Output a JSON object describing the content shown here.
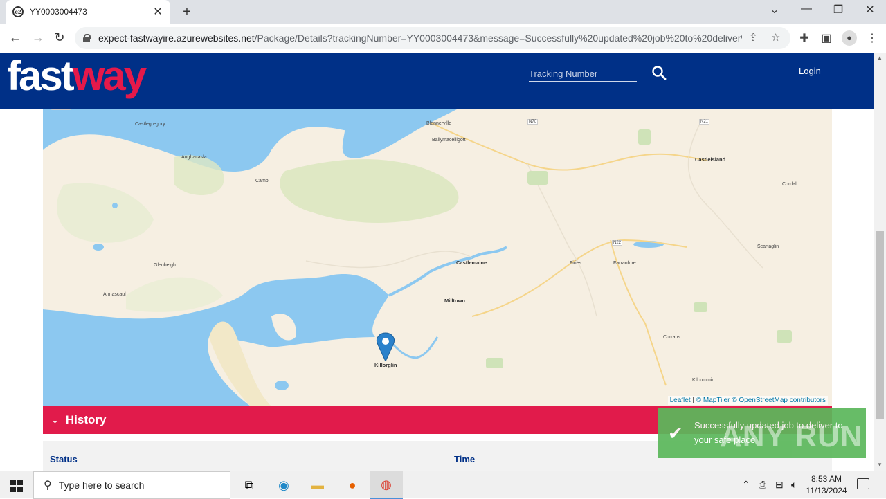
{
  "browser": {
    "tab_title": "YY0003004473",
    "url_host": "expect-fastwayire.azurewebsites.net",
    "url_path": "/Package/Details?trackingNumber=YY0003004473&message=Successfully%20updated%20job%20to%20deliver%..."
  },
  "header": {
    "logo_part1": "fast",
    "logo_part2": "way",
    "tracking_placeholder": "Tracking Number",
    "login_label": "Login"
  },
  "map": {
    "places": [
      {
        "name": "Castlegregory",
        "big": false
      },
      {
        "name": "Aughacasla",
        "big": false
      },
      {
        "name": "Camp",
        "big": false
      },
      {
        "name": "Glenbeigh",
        "big": false
      },
      {
        "name": "Annascaul",
        "big": false
      },
      {
        "name": "Castlemaine",
        "big": true
      },
      {
        "name": "Milltown",
        "big": true
      },
      {
        "name": "Killorglin",
        "big": true
      },
      {
        "name": "Firies",
        "big": false
      },
      {
        "name": "Farranfore",
        "big": false
      },
      {
        "name": "Castleisland",
        "big": true
      },
      {
        "name": "Scartaglin",
        "big": false
      },
      {
        "name": "Currans",
        "big": false
      },
      {
        "name": "Cordal",
        "big": false
      },
      {
        "name": "Kilcummin",
        "big": false
      },
      {
        "name": "Blennerville",
        "big": false
      },
      {
        "name": "Ballymacelligott",
        "big": false
      },
      {
        "name": "N22",
        "big": false
      },
      {
        "name": "N70",
        "big": false
      },
      {
        "name": "N21",
        "big": false
      }
    ],
    "attribution": {
      "leaflet": "Leaflet",
      "maptiler": "© MapTiler",
      "osm": "© OpenStreetMap contributors",
      "sep": " | "
    },
    "water_color": "#8cc8f0",
    "land_color": "#f6efe2",
    "forest_color": "#dfe8c4",
    "marker_color": "#2a81cb"
  },
  "history": {
    "title": "History",
    "columns": {
      "status": "Status",
      "time": "Time"
    },
    "bar_color": "#e11b4b"
  },
  "toast": {
    "message": "Successfully updated job to deliver to your safe place",
    "color": "#5cb85c"
  },
  "watermark": "ANY RUN",
  "taskbar": {
    "search_placeholder": "Type here to search",
    "time": "8:53 AM",
    "date": "11/13/2024"
  }
}
